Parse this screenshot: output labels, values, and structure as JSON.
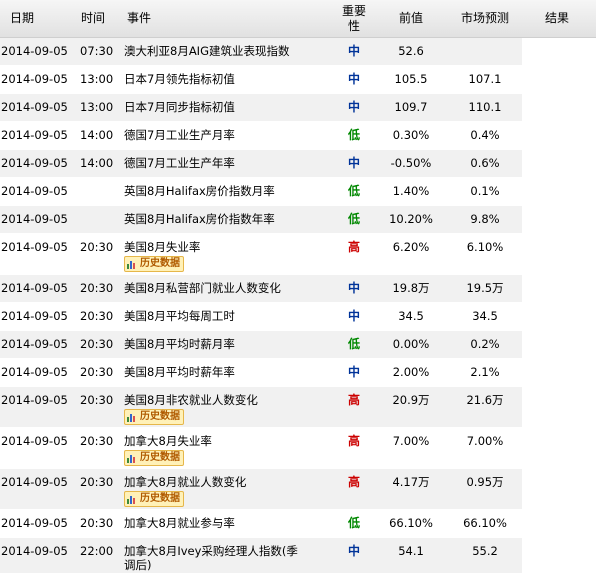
{
  "header": {
    "date": "日期",
    "time": "时间",
    "event": "事件",
    "importance": "重要\n性",
    "previous": "前值",
    "forecast": "市场预测",
    "result": "结果"
  },
  "history_label": "历史数据",
  "rows": [
    {
      "date": "2014-09-05",
      "time": "07:30",
      "event": "澳大利亚8月AIG建筑业表现指数",
      "importance": "中",
      "level": "mid",
      "previous": "52.6",
      "forecast": "",
      "result": "",
      "history": false
    },
    {
      "date": "2014-09-05",
      "time": "13:00",
      "event": "日本7月领先指标初值",
      "importance": "中",
      "level": "mid",
      "previous": "105.5",
      "forecast": "107.1",
      "result": "",
      "history": false
    },
    {
      "date": "2014-09-05",
      "time": "13:00",
      "event": "日本7月同步指标初值",
      "importance": "中",
      "level": "mid",
      "previous": "109.7",
      "forecast": "110.1",
      "result": "",
      "history": false
    },
    {
      "date": "2014-09-05",
      "time": "14:00",
      "event": "德国7月工业生产月率",
      "importance": "低",
      "level": "low",
      "previous": "0.30%",
      "forecast": "0.4%",
      "result": "",
      "history": false
    },
    {
      "date": "2014-09-05",
      "time": "14:00",
      "event": "德国7月工业生产年率",
      "importance": "中",
      "level": "mid",
      "previous": "-0.50%",
      "forecast": "0.6%",
      "result": "",
      "history": false
    },
    {
      "date": "2014-09-05",
      "time": "",
      "event": "英国8月Halifax房价指数月率",
      "importance": "低",
      "level": "low",
      "previous": "1.40%",
      "forecast": "0.1%",
      "result": "",
      "history": false
    },
    {
      "date": "2014-09-05",
      "time": "",
      "event": "英国8月Halifax房价指数年率",
      "importance": "低",
      "level": "low",
      "previous": "10.20%",
      "forecast": "9.8%",
      "result": "",
      "history": false
    },
    {
      "date": "2014-09-05",
      "time": "20:30",
      "event": "美国8月失业率",
      "importance": "高",
      "level": "high",
      "previous": "6.20%",
      "forecast": "6.10%",
      "result": "",
      "history": true
    },
    {
      "date": "2014-09-05",
      "time": "20:30",
      "event": "美国8月私营部门就业人数变化",
      "importance": "中",
      "level": "mid",
      "previous": "19.8万",
      "forecast": "19.5万",
      "result": "",
      "history": false
    },
    {
      "date": "2014-09-05",
      "time": "20:30",
      "event": "美国8月平均每周工时",
      "importance": "中",
      "level": "mid",
      "previous": "34.5",
      "forecast": "34.5",
      "result": "",
      "history": false
    },
    {
      "date": "2014-09-05",
      "time": "20:30",
      "event": "美国8月平均时薪月率",
      "importance": "低",
      "level": "low",
      "previous": "0.00%",
      "forecast": "0.2%",
      "result": "",
      "history": false
    },
    {
      "date": "2014-09-05",
      "time": "20:30",
      "event": "美国8月平均时薪年率",
      "importance": "中",
      "level": "mid",
      "previous": "2.00%",
      "forecast": "2.1%",
      "result": "",
      "history": false
    },
    {
      "date": "2014-09-05",
      "time": "20:30",
      "event": "美国8月非农就业人数变化",
      "importance": "高",
      "level": "high",
      "previous": "20.9万",
      "forecast": "21.6万",
      "result": "",
      "history": true
    },
    {
      "date": "2014-09-05",
      "time": "20:30",
      "event": "加拿大8月失业率",
      "importance": "高",
      "level": "high",
      "previous": "7.00%",
      "forecast": "7.00%",
      "result": "",
      "history": true
    },
    {
      "date": "2014-09-05",
      "time": "20:30",
      "event": "加拿大8月就业人数变化",
      "importance": "高",
      "level": "high",
      "previous": "4.17万",
      "forecast": "0.95万",
      "result": "",
      "history": true
    },
    {
      "date": "2014-09-05",
      "time": "20:30",
      "event": "加拿大8月就业参与率",
      "importance": "低",
      "level": "low",
      "previous": "66.10%",
      "forecast": "66.10%",
      "result": "",
      "history": false
    },
    {
      "date": "2014-09-05",
      "time": "22:00",
      "event": "加拿大8月Ivey采购经理人指数(季调后)",
      "importance": "中",
      "level": "mid",
      "previous": "54.1",
      "forecast": "55.2",
      "result": "",
      "history": false
    }
  ]
}
